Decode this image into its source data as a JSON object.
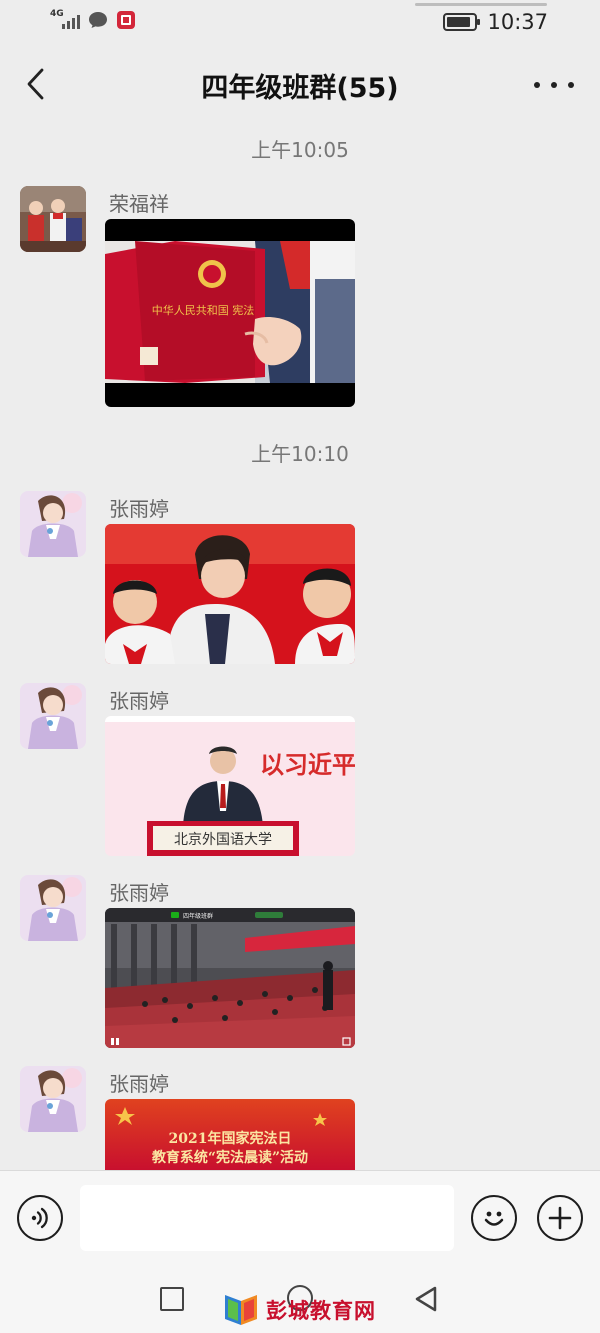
{
  "status_bar": {
    "network_label": "4G",
    "time": "10:37",
    "battery_level": 0.85,
    "notification_icons": [
      "chat-bubble-icon",
      "app-notification-icon"
    ]
  },
  "header": {
    "title": "四年级班群(55)",
    "back_icon": "chevron-left-icon",
    "more_icon": "more-dots-icon"
  },
  "messages": [
    {
      "type": "timestamp",
      "text": "上午10:05"
    },
    {
      "type": "media",
      "sender": "荣福祥",
      "content": "image",
      "image_text": "中华人民共和国 宪法"
    },
    {
      "type": "timestamp",
      "text": "上午10:10"
    },
    {
      "type": "media",
      "sender": "张雨婷",
      "content": "image"
    },
    {
      "type": "media",
      "sender": "张雨婷",
      "content": "image",
      "image_text": "以习近平",
      "podium_text": "北京外国语大学"
    },
    {
      "type": "media",
      "sender": "张雨婷",
      "content": "video",
      "video_caption": "四年级班群"
    },
    {
      "type": "media",
      "sender": "张雨婷",
      "content": "image",
      "image_line1": "2021年国家宪法日",
      "image_line2": "教育系统“宪法晨读”活动"
    }
  ],
  "input_bar": {
    "voice_icon": "voice-icon",
    "emoji_icon": "emoji-icon",
    "plus_icon": "plus-icon",
    "input_value": ""
  },
  "navbar": {
    "watermark": "彭城教育网"
  },
  "colors": {
    "background": "#ededed",
    "bar_background": "#f6f6f6",
    "constitution_red": "#c8102e",
    "watermark_red": "#c8102e"
  }
}
